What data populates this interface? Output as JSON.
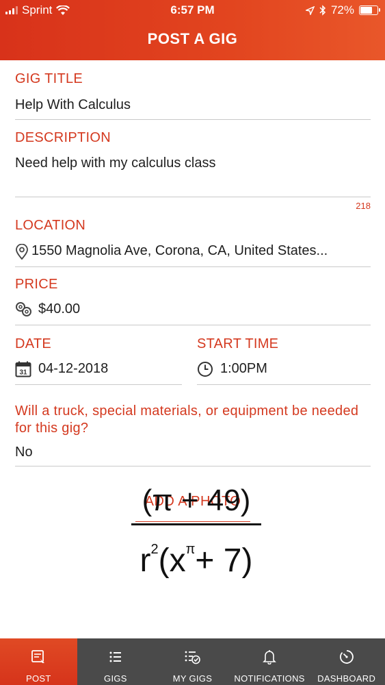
{
  "status_bar": {
    "carrier": "Sprint",
    "time": "6:57 PM",
    "battery": "72%",
    "battery_level": 0.72
  },
  "header": {
    "title": "POST A GIG"
  },
  "form": {
    "gig_title": {
      "label": "GIG TITLE",
      "value": "Help With Calculus"
    },
    "description": {
      "label": "DESCRIPTION",
      "value": "Need help with my calculus class",
      "char_count": "218"
    },
    "location": {
      "label": "LOCATION",
      "value": "1550 Magnolia Ave, Corona, CA, United States..."
    },
    "price": {
      "label": "PRICE",
      "value": "$40.00"
    },
    "date": {
      "label": "DATE",
      "value": "04-12-2018",
      "calendar_day": "31"
    },
    "start_time": {
      "label": "START TIME",
      "value": "1:00PM"
    },
    "equipment_question": {
      "label": "Will a truck, special materials, or equipment be needed for this gig?",
      "value": "No"
    }
  },
  "add_photo": {
    "label": "ADD A PHOTO"
  },
  "photo_formula": {
    "numerator": "(π + 49)",
    "denominator_base": "r",
    "denominator_exp": "2",
    "denominator_rest": "(x",
    "denominator_exp2": "π",
    "denominator_tail": "+ 7)"
  },
  "tabs": [
    {
      "label": "POST",
      "icon": "post-icon",
      "active": true
    },
    {
      "label": "GIGS",
      "icon": "list-icon",
      "active": false
    },
    {
      "label": "MY GIGS",
      "icon": "checklist-icon",
      "active": false
    },
    {
      "label": "NOTIFICATIONS",
      "icon": "bell-icon",
      "active": false
    },
    {
      "label": "DASHBOARD",
      "icon": "dashboard-icon",
      "active": false
    }
  ],
  "colors": {
    "accent": "#d4391f",
    "tabbar": "#4a4a4a",
    "header": "#e2451f"
  }
}
